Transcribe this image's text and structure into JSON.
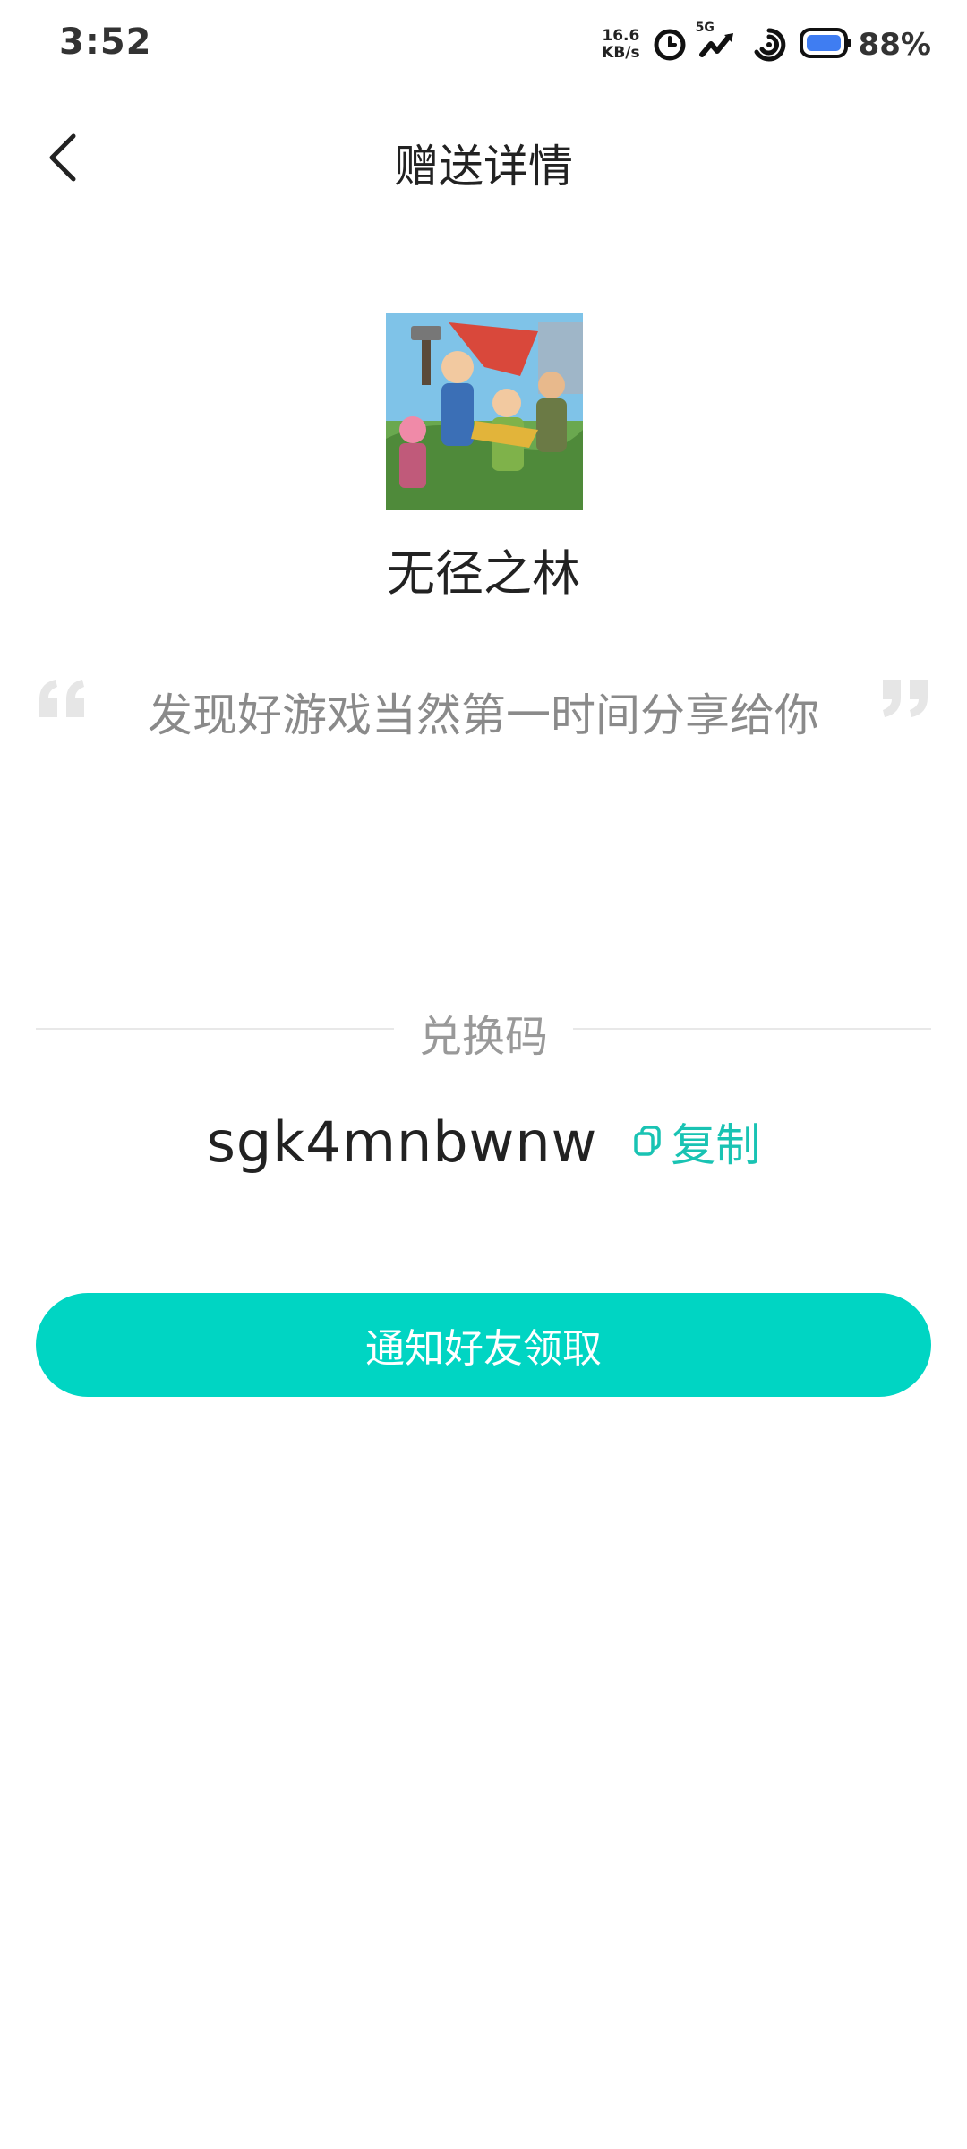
{
  "status_bar": {
    "time": "3:52",
    "net_speed_value": "16.6",
    "net_speed_unit": "KB/s",
    "signal_label": "5G",
    "battery_percent": "88%"
  },
  "header": {
    "title": "赠送详情"
  },
  "game": {
    "name": "无径之林"
  },
  "quote": {
    "text": "发现好游戏当然第一时间分享给你"
  },
  "redeem": {
    "label": "兑换码",
    "code": "sgk4mnbwnw",
    "copy_label": "复制"
  },
  "actions": {
    "notify_label": "通知好友领取"
  },
  "colors": {
    "accent": "#00d5c3",
    "copy_text": "#19c3b3",
    "muted_text": "#8a8a8a"
  }
}
